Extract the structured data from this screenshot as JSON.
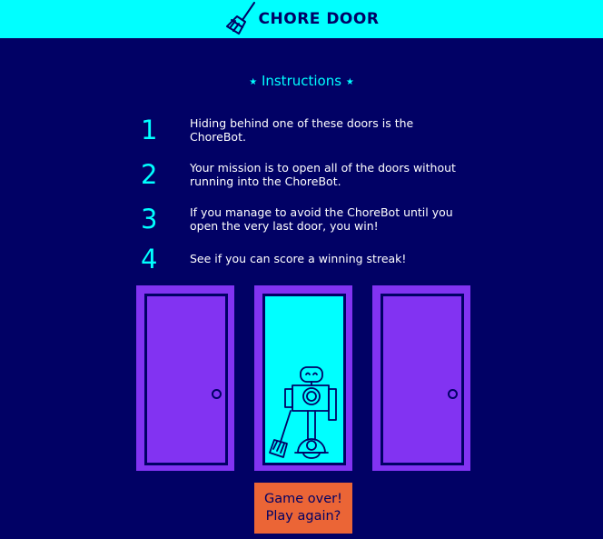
{
  "header": {
    "title": "CHORE DOOR",
    "logo_icon": "broom-icon"
  },
  "instructions": {
    "title": "Instructions",
    "star": "★",
    "steps": [
      {
        "number": "1",
        "text": "Hiding behind one of these doors is the ChoreBot."
      },
      {
        "number": "2",
        "text": "Your mission is to open all of the doors without running into the ChoreBot."
      },
      {
        "number": "3",
        "text": "If you manage to avoid the ChoreBot until you open the very last door, you win!"
      },
      {
        "number": "4",
        "text": "See if you can score a winning streak!"
      }
    ]
  },
  "doors": [
    {
      "state": "closed"
    },
    {
      "state": "open",
      "content": "chorebot"
    },
    {
      "state": "closed"
    }
  ],
  "game": {
    "button_label": "Game over!\nPlay again?"
  },
  "colors": {
    "background": "#010165",
    "accent": "#00ffff",
    "door": "#8233f2",
    "button": "#eb6536"
  }
}
